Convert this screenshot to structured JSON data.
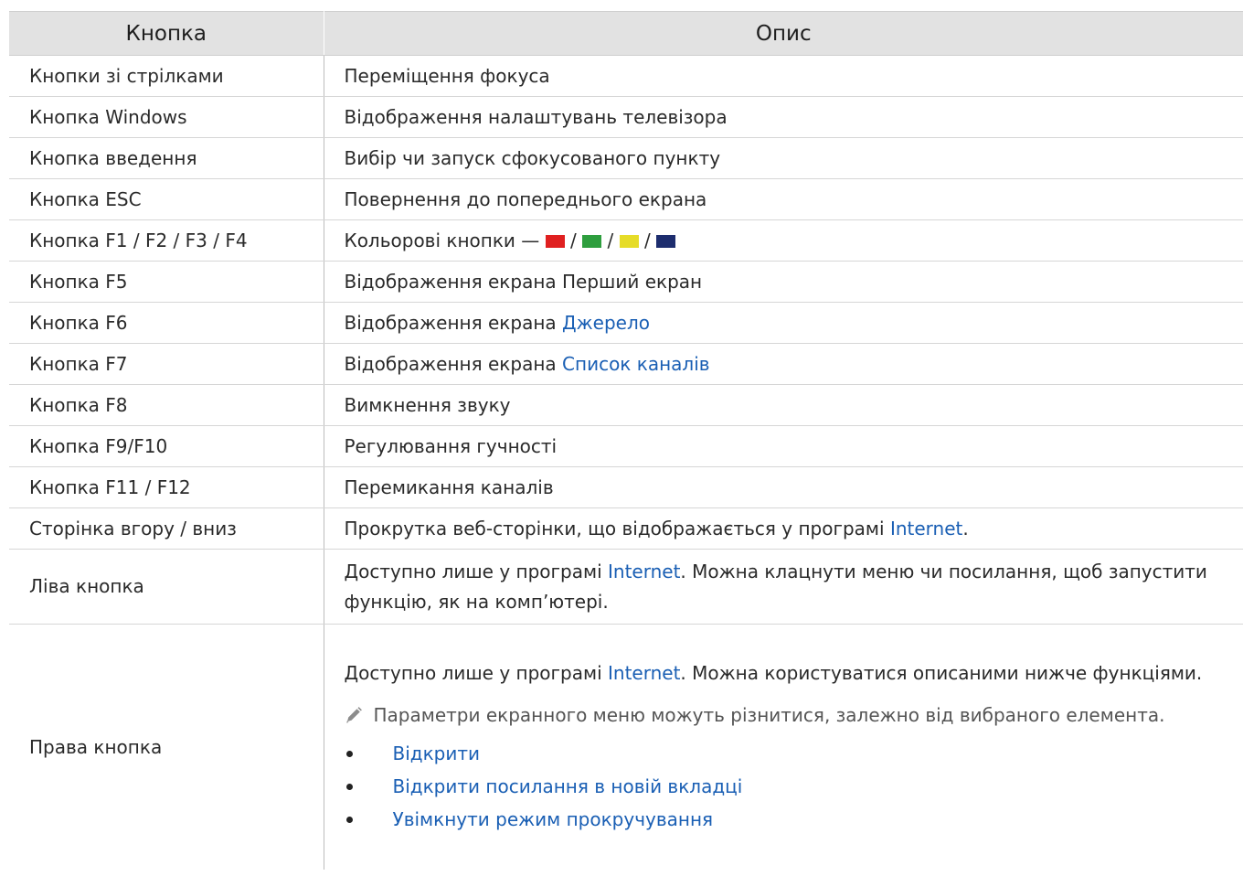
{
  "table": {
    "headers": [
      "Кнопка",
      "Опис"
    ],
    "rows": [
      {
        "key": "Кнопки зі стрілками",
        "desc": "Переміщення фокуса"
      },
      {
        "key": "Кнопка Windows",
        "desc": "Відображення налаштувань телевізора"
      },
      {
        "key": "Кнопка введення",
        "desc": "Вибір чи запуск сфокусованого пункту"
      },
      {
        "key": "Кнопка ESC",
        "desc": "Повернення до попереднього екрана"
      },
      {
        "key": "Кнопка F1 / F2 / F3 / F4",
        "desc_prefix": "Кольорові кнопки —",
        "sep": "/",
        "color_keys": [
          "#e02020",
          "#2e9e3e",
          "#e6dc28",
          "#1d2d6e"
        ]
      },
      {
        "key": "Кнопка F5",
        "desc": "Відображення екрана Перший екран"
      },
      {
        "key": "Кнопка F6",
        "desc_prefix": "Відображення екрана",
        "desc_link": "Джерело"
      },
      {
        "key": "Кнопка F7",
        "desc_prefix": "Відображення екрана",
        "desc_link": "Список каналів"
      },
      {
        "key": "Кнопка F8",
        "desc": "Вимкнення звуку"
      },
      {
        "key": "Кнопка F9/F10",
        "desc": "Регулювання гучності"
      },
      {
        "key": "Кнопка F11 / F12",
        "desc": "Перемикання каналів"
      },
      {
        "key": "Сторінка вгору / вниз",
        "desc_prefix": "Прокрутка веб-сторінки, що відображається у програмі",
        "desc_link": "Internet",
        "desc_suffix": "."
      },
      {
        "key": "Ліва кнопка",
        "desc_prefix": "Доступно лише у програмі",
        "desc_link": "Internet",
        "desc_suffix": ". Можна клацнути меню чи посилання, щоб запустити функцію, як на комп’ютері."
      },
      {
        "key": "Права кнопка",
        "desc_prefix": "Доступно лише у програмі",
        "desc_link": "Internet",
        "desc_suffix": ". Можна користуватися описаними нижче функціями.",
        "note_icon": "pencil-icon",
        "note": "Параметри екранного меню можуть різнитися, залежно від вибраного елемента.",
        "options": [
          "Відкрити",
          "Відкрити посилання в новій вкладці",
          "Увімкнути режим прокручування"
        ]
      }
    ]
  },
  "colors": {
    "link": "#1a5fb4",
    "header_bg": "#e2e2e2"
  }
}
